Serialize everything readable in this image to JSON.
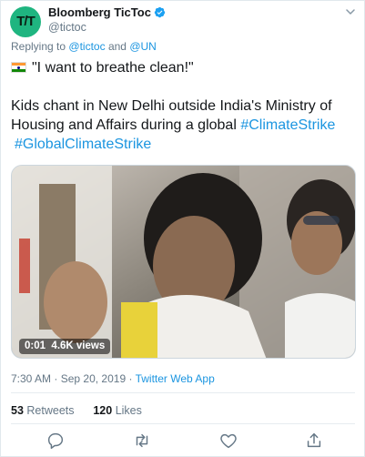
{
  "author": {
    "avatar_text": "T/T",
    "display_name": "Bloomberg TicToc",
    "handle": "@tictoc"
  },
  "reply": {
    "prefix": "Replying to",
    "mention1": "@tictoc",
    "joiner": "and",
    "mention2": "@UN"
  },
  "tweet": {
    "quote": "\"I want to breathe clean!\"",
    "body_line1": "Kids chant in New Delhi outside India's Ministry of",
    "body_line2_text": "Housing and Affairs during a global",
    "hashtag1": "#ClimateStrike",
    "hashtag2": "#GlobalClimateStrike"
  },
  "media": {
    "video_time": "0:01",
    "views": "4.6K views"
  },
  "meta": {
    "time": "7:30 AM",
    "separator": "·",
    "date": "Sep 20, 2019",
    "separator2": "·",
    "app": "Twitter Web App"
  },
  "stats": {
    "retweets_count": "53",
    "retweets_label": "Retweets",
    "likes_count": "120",
    "likes_label": "Likes"
  },
  "icons": {
    "verified": "verified-badge-icon",
    "chevron": "chevron-down-icon",
    "reply": "reply-icon",
    "retweet": "retweet-icon",
    "like": "heart-icon",
    "share": "share-icon"
  },
  "colors": {
    "link": "#1b95e0",
    "muted": "#657786",
    "avatar_bg": "#1fb580"
  }
}
